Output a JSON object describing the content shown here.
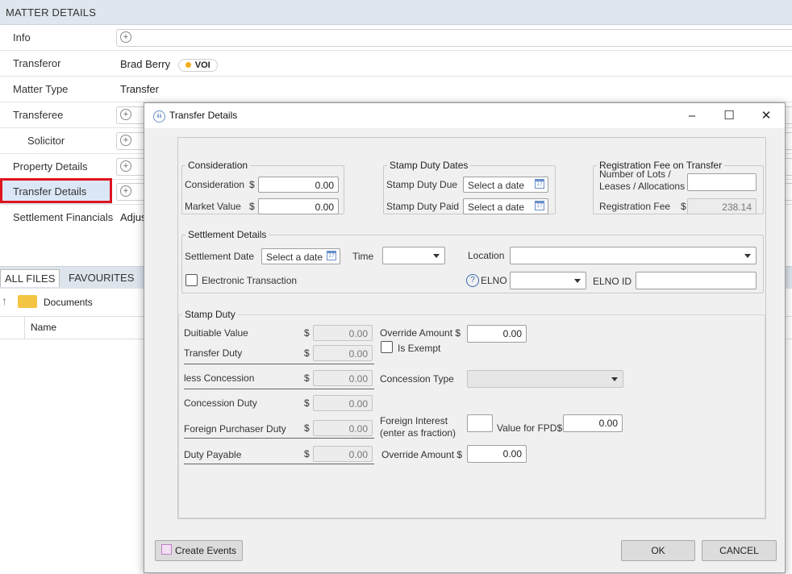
{
  "matter": {
    "header": "MATTER DETAILS",
    "rows": {
      "info": "Info",
      "transferor": "Transferor",
      "transferor_value": "Brad Berry",
      "voi": "VOI",
      "matter_type": "Matter Type",
      "matter_type_value": "Transfer",
      "transferee": "Transferee",
      "solicitor": "Solicitor",
      "property_details": "Property Details",
      "transfer_details": "Transfer Details",
      "settlement_financials": "Settlement Financials",
      "settlement_financials_value": "Adjus"
    }
  },
  "files": {
    "tab_all": "ALL FILES",
    "tab_favourites": "FAVOURITES",
    "folder": "Documents",
    "column_name": "Name"
  },
  "dialog": {
    "title": "Transfer Details",
    "consideration": {
      "legend": "Consideration",
      "consideration_label": "Consideration",
      "consideration_value": "0.00",
      "market_value_label": "Market Value",
      "market_value_value": "0.00",
      "currency": "$"
    },
    "stamp_dates": {
      "legend": "Stamp Duty Dates",
      "due_label": "Stamp Duty Due",
      "due_placeholder": "Select a date",
      "paid_label": "Stamp Duty Paid",
      "paid_placeholder": "Select a date"
    },
    "registration": {
      "legend": "Registration Fee on Transfer",
      "lots_label_1": "Number of Lots /",
      "lots_label_2": "Leases / Allocations",
      "lots_value": "",
      "fee_label": "Registration Fee",
      "currency": "$",
      "fee_value": "238.14"
    },
    "settlement": {
      "legend": "Settlement Details",
      "date_label": "Settlement Date",
      "date_placeholder": "Select a date",
      "time_label": "Time",
      "location_label": "Location",
      "electronic_label": "Electronic Transaction",
      "elno_label": "ELNO",
      "elno_id_label": "ELNO ID"
    },
    "stamp_duty": {
      "legend": "Stamp Duty",
      "currency": "$",
      "dutiable_label": "Duitiable Value",
      "dutiable_value": "0.00",
      "transfer_duty_label": "Transfer Duty",
      "transfer_duty_value": "0.00",
      "less_concession_label": "less Concession",
      "less_concession_value": "0.00",
      "concession_duty_label": "Concession Duty",
      "concession_duty_value": "0.00",
      "foreign_duty_label": "Foreign Purchaser Duty",
      "foreign_duty_value": "0.00",
      "duty_payable_label": "Duty Payable",
      "duty_payable_value": "0.00",
      "override_label": "Override Amount $",
      "override_value": "0.00",
      "is_exempt_label": "Is Exempt",
      "concession_type_label": "Concession Type",
      "foreign_interest_label_1": "Foreign Interest",
      "foreign_interest_label_2": "(enter as fraction)",
      "value_fpd_label": "Value for FPD$",
      "value_fpd_value": "0.00",
      "override2_label": "Override Amount $",
      "override2_value": "0.00"
    },
    "buttons": {
      "create_events": "Create Events",
      "ok": "OK",
      "cancel": "CANCEL"
    }
  }
}
